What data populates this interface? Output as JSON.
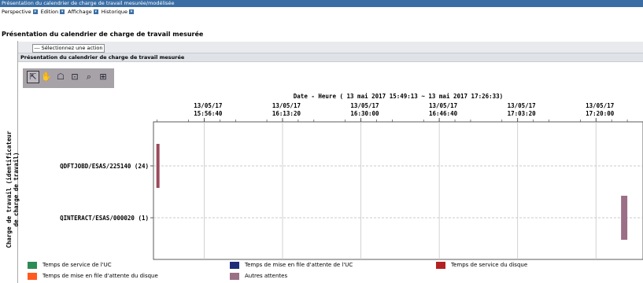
{
  "window": {
    "title": "Présentation du calendrier de charge de travail mesurée/modélisée"
  },
  "menu": [
    {
      "label": "Perspective",
      "icon": "dropdown-arrow-icon"
    },
    {
      "label": "Edition",
      "icon": "dropdown-arrow-icon"
    },
    {
      "label": "Affichage",
      "icon": "dropdown-arrow-icon"
    },
    {
      "label": "Historique",
      "icon": "dropdown-arrow-icon"
    }
  ],
  "page": {
    "heading": "Présentation du calendrier de charge de travail mesurée"
  },
  "actions": {
    "select_label": "--- Sélectionnez une action --- ▼"
  },
  "panel": {
    "title": "Présentation du calendrier de charge de travail mesurée"
  },
  "toolbar": [
    {
      "name": "select-pointer-icon",
      "glyph": "⇱",
      "selected": true
    },
    {
      "name": "pan-hand-icon",
      "glyph": "✋",
      "selected": false
    },
    {
      "name": "annotation-icon",
      "glyph": "☖",
      "selected": false
    },
    {
      "name": "zoom-box-icon",
      "glyph": "⊡",
      "selected": false
    },
    {
      "name": "zoom-magnifier-icon",
      "glyph": "⌕",
      "selected": false
    },
    {
      "name": "crosshair-icon",
      "glyph": "⊞",
      "selected": false
    }
  ],
  "chart_data": {
    "type": "timeline",
    "title": "Date - Heure ( 13 mai 2017 15:49:13 ~ 13 mai 2017 17:26:33)",
    "ylabel": "Charge de travail (identificateur de charge de travail)",
    "x_tick_dates": [
      "13/05/17",
      "13/05/17",
      "13/05/17",
      "13/05/17",
      "13/05/17",
      "13/05/17"
    ],
    "x_tick_times": [
      "15:56:40",
      "16:13:20",
      "16:30:00",
      "16:46:40",
      "17:03:20",
      "17:20:00"
    ],
    "x_tick_seconds": [
      27400,
      28400,
      29400,
      30400,
      31400,
      32400
    ],
    "x_range_seconds": [
      26753,
      33000
    ],
    "categories": [
      "QDFTJOBD/ESAS/225140 (24)",
      "QINTERACT/ESAS/000020 (1)"
    ],
    "segments": [
      {
        "category": 0,
        "start": 26790,
        "end": 26830,
        "color": "#9c4a5c"
      },
      {
        "category": 1,
        "start": 32720,
        "end": 32800,
        "color": "#9b6f86"
      }
    ],
    "grid": true,
    "legend": [
      {
        "label": "Temps de service de l'UC",
        "color": "#2e8b57"
      },
      {
        "label": "Temps de mise en file d'attente de l'UC",
        "color": "#1f2a78"
      },
      {
        "label": "Temps de service du disque",
        "color": "#b22222"
      },
      {
        "label": "Temps de mise en file d'attente du disque",
        "color": "#ff5a1f"
      },
      {
        "label": "Autres attentes",
        "color": "#9b6f86"
      }
    ]
  }
}
